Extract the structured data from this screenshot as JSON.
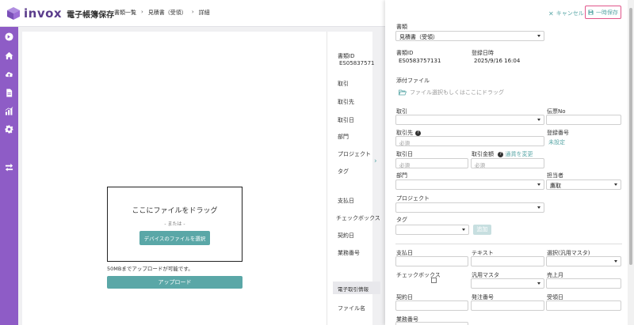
{
  "header": {
    "logo_text": "invox",
    "logo_sub": "電子帳簿保存",
    "breadcrumb": [
      "書類一覧",
      "見積書（受領）",
      "詳細"
    ],
    "breadcrumb_sep": "›"
  },
  "sidebar": {
    "icons": [
      "arrow-right-circle-icon",
      "home-icon",
      "cloud-upload-icon",
      "document-icon",
      "chart-icon",
      "gear-icon",
      "transfer-icon"
    ]
  },
  "viewer": {
    "drop_title": "ここにファイルをドラッグ",
    "drop_or": "- または -",
    "select_button": "デバイスのファイルを選択",
    "size_note": "50MBまでアップロードが可能です。",
    "upload_button": "アップロード"
  },
  "background_fields": {
    "doc_id_label": "書類ID",
    "doc_id_value": "ES05837571",
    "labels": [
      "取引",
      "取引先",
      "取引日",
      "部門",
      "プロジェクト",
      "タグ",
      "支払日",
      "チェックボックス",
      "契約日",
      "業務番号"
    ],
    "section_label": "電子取引情報",
    "file_name_label": "ファイル名"
  },
  "drawer": {
    "cancel_label": "キャンセル",
    "save_label": "一時保存",
    "doc_type_label": "書類",
    "doc_type_value": "見積書（受領）",
    "doc_id_label": "書類ID",
    "doc_id_value": "ES0583757131",
    "registered_label": "登録日時",
    "registered_value": "2025/9/16 16:04",
    "attachment_label": "添付ファイル",
    "attachment_placeholder": "ファイル選択もしくはここにドラッグ",
    "transaction_label": "取引",
    "slip_no_label": "伝票No",
    "partner_label": "取引先",
    "partner_placeholder": "必須",
    "reg_number_label": "登録番号",
    "reg_number_value": "未設定",
    "trade_date_label": "取引日",
    "trade_date_placeholder": "必須",
    "amount_label": "取引金額",
    "amount_placeholder": "必須",
    "currency_link": "通貨を変更",
    "department_label": "部門",
    "person_label": "担当者",
    "person_value": "鷹取",
    "project_label": "プロジェクト",
    "tag_label": "タグ",
    "add_button": "追加",
    "pay_date_label": "支払日",
    "text_label": "テキスト",
    "select_master_label": "選択(汎用マスタ)",
    "checkbox_label": "チェックボックス",
    "general_master_label": "汎用マスタ",
    "sales_month_label": "売上月",
    "contract_date_label": "契約日",
    "order_no_label": "発注番号",
    "receive_date_label": "受領日",
    "business_no_label": "業務番号"
  },
  "colors": {
    "brand_purple": "#8e5cc6",
    "accent_teal": "#5aa7a7",
    "highlight_pink": "#e0558a"
  }
}
